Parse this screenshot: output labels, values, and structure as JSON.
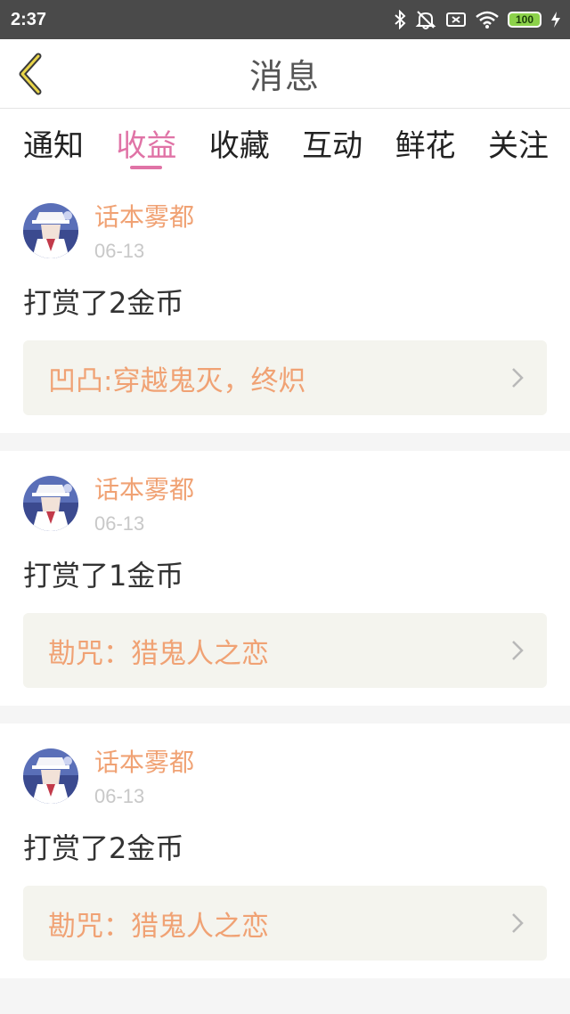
{
  "status_bar": {
    "time": "2:37",
    "battery": "100",
    "icons": [
      "bluetooth-icon",
      "bell-off-icon",
      "sim-x-icon",
      "wifi-icon",
      "battery-icon",
      "charging-icon"
    ]
  },
  "header": {
    "title": "消息",
    "back_icon": "chevron-left-icon"
  },
  "tabs": [
    {
      "label": "通知",
      "active": false
    },
    {
      "label": "收益",
      "active": true
    },
    {
      "label": "收藏",
      "active": false
    },
    {
      "label": "互动",
      "active": false
    },
    {
      "label": "鲜花",
      "active": false
    },
    {
      "label": "关注",
      "active": false
    }
  ],
  "colors": {
    "accent_pink": "#e073a6",
    "username_orange": "#f0a274",
    "status_bar": "#4a4a4a"
  },
  "messages": [
    {
      "username": "话本雾都",
      "date": "06-13",
      "text": "打赏了2金币",
      "book": "凹凸:穿越鬼灭，终炽"
    },
    {
      "username": "话本雾都",
      "date": "06-13",
      "text": "打赏了1金币",
      "book": "勘咒：猎鬼人之恋"
    },
    {
      "username": "话本雾都",
      "date": "06-13",
      "text": "打赏了2金币",
      "book": "勘咒：猎鬼人之恋"
    }
  ]
}
